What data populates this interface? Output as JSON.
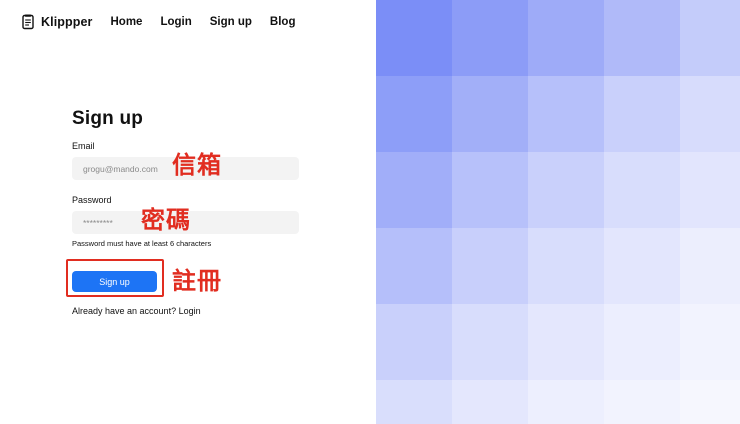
{
  "nav": {
    "brand": "Klippper",
    "links": [
      "Home",
      "Login",
      "Sign up",
      "Blog"
    ]
  },
  "form": {
    "title": "Sign up",
    "email_label": "Email",
    "email_placeholder": "grogu@mando.com",
    "password_label": "Password",
    "password_placeholder": "*********",
    "password_hint": "Password must have at least 6 characters",
    "submit_label": "Sign up",
    "login_prompt": "Already have an account? Login"
  },
  "annotations": {
    "email": "信箱",
    "password": "密碼",
    "signup": "註冊",
    "color": "#e12d20"
  },
  "colors": {
    "accent": "#1d74f5",
    "input_bg": "#f3f3f3"
  },
  "grid_colors": [
    [
      "#7b8ef7",
      "#8c9cf7",
      "#9eabf8",
      "#b0baf9",
      "#c4ccfa"
    ],
    [
      "#8d9ef8",
      "#a2aff8",
      "#b6c0fa",
      "#c9d0fb",
      "#d7dcfc"
    ],
    [
      "#a1aef9",
      "#b7c1fa",
      "#c9d0fb",
      "#d8ddfc",
      "#e2e5fd"
    ],
    [
      "#b5bffa",
      "#c8cffb",
      "#d8ddfc",
      "#e3e6fd",
      "#eceefd"
    ],
    [
      "#c9d0fb",
      "#d8ddfc",
      "#e4e7fd",
      "#eceefe",
      "#f2f3fe"
    ],
    [
      "#d9defc",
      "#e4e7fd",
      "#edeffe",
      "#f2f3fe",
      "#f6f7fe"
    ]
  ]
}
